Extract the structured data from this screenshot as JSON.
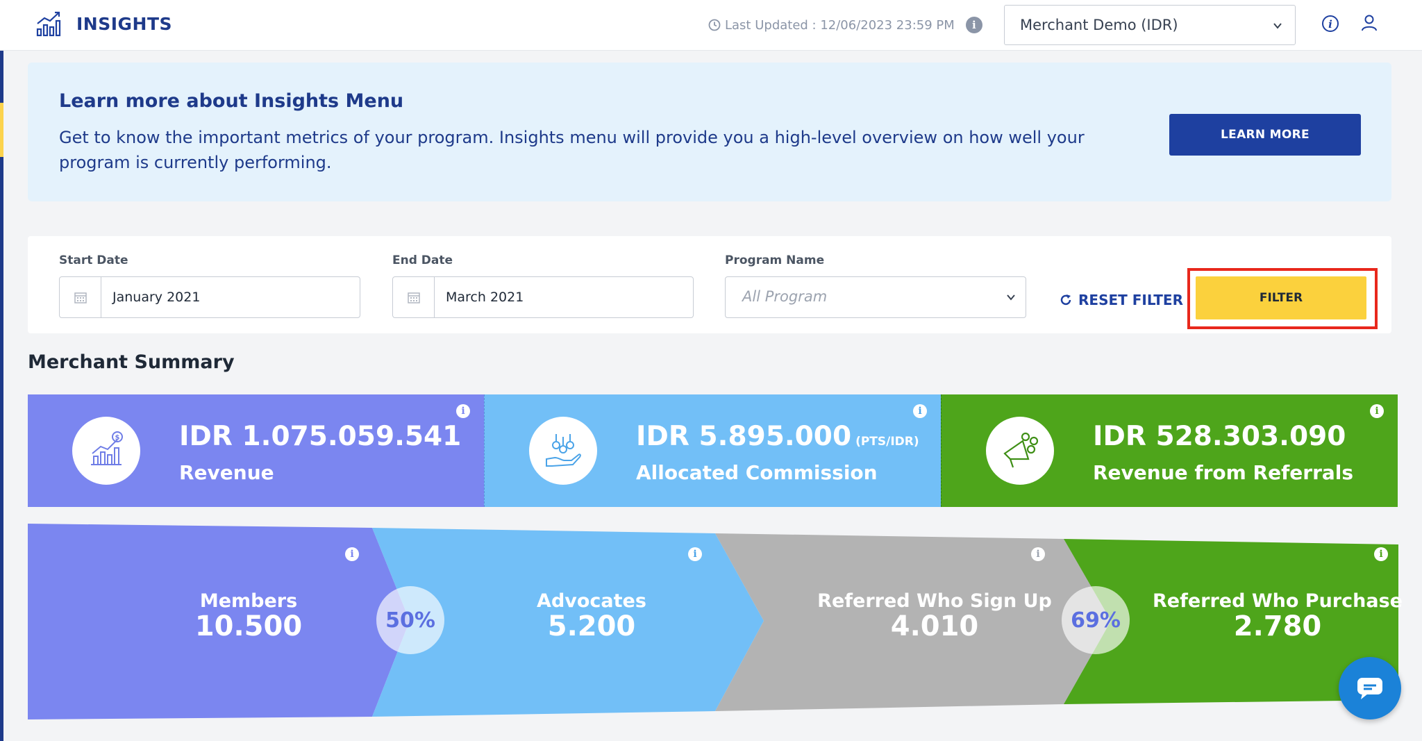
{
  "header": {
    "app_title": "INSIGHTS",
    "last_updated": "Last Updated : 12/06/2023 23:59 PM",
    "merchant_selected": "Merchant Demo (IDR)",
    "icons": [
      "insights-chart-icon",
      "clock-icon",
      "info-icon",
      "chevron-down-icon",
      "help-info-icon",
      "user-icon"
    ]
  },
  "banner": {
    "title": "Learn more about Insights Menu",
    "text": "Get to know the important metrics of your program. Insights menu will provide you a high-level overview on how well your program is currently performing.",
    "button": "LEARN MORE"
  },
  "filters": {
    "start_label": "Start Date",
    "start_value": "January 2021",
    "end_label": "End Date",
    "end_value": "March 2021",
    "program_label": "Program Name",
    "program_placeholder": "All Program",
    "reset_label": "RESET FILTER",
    "filter_label": "FILTER"
  },
  "summary": {
    "title": "Merchant Summary",
    "cards": [
      {
        "amount": "IDR 1.075.059.541",
        "unit": "",
        "label": "Revenue",
        "color": "#7b86f0"
      },
      {
        "amount": "IDR 5.895.000",
        "unit": "(PTS/IDR)",
        "label": "Allocated Commission",
        "color": "#72bff7"
      },
      {
        "amount": "IDR 528.303.090",
        "unit": "",
        "label": "Revenue from Referrals",
        "color": "#4ea51b"
      }
    ]
  },
  "funnel": {
    "stages": [
      {
        "label": "Members",
        "value": "10.500",
        "color": "#7b86f0"
      },
      {
        "label": "Advocates",
        "value": "5.200",
        "color": "#72bff7"
      },
      {
        "label": "Referred Who Sign Up",
        "value": "4.010",
        "color": "#b3b3b3"
      },
      {
        "label": "Referred Who Purchase",
        "value": "2.780",
        "color": "#4ea51b"
      }
    ],
    "conversions": [
      "50%",
      "69%"
    ]
  }
}
